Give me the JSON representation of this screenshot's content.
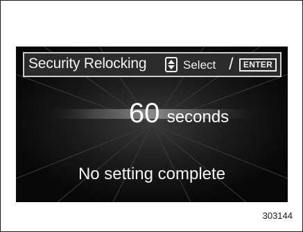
{
  "screen": {
    "title": "Security Relocking",
    "select_label": "Select",
    "separator": "/",
    "enter_key_label": "ENTER",
    "value_number": "60",
    "value_unit": "seconds",
    "status_message": "No setting complete",
    "icons": {
      "updown": "up-down-arrow-icon"
    }
  },
  "figure_number": "303144",
  "colors": {
    "screen_background": "#0c0c0c",
    "title_bar_background": "#2b2b2b",
    "title_bar_border": "#cfcfcf",
    "text": "#f2f2f2",
    "page_background": "#ffffff"
  }
}
